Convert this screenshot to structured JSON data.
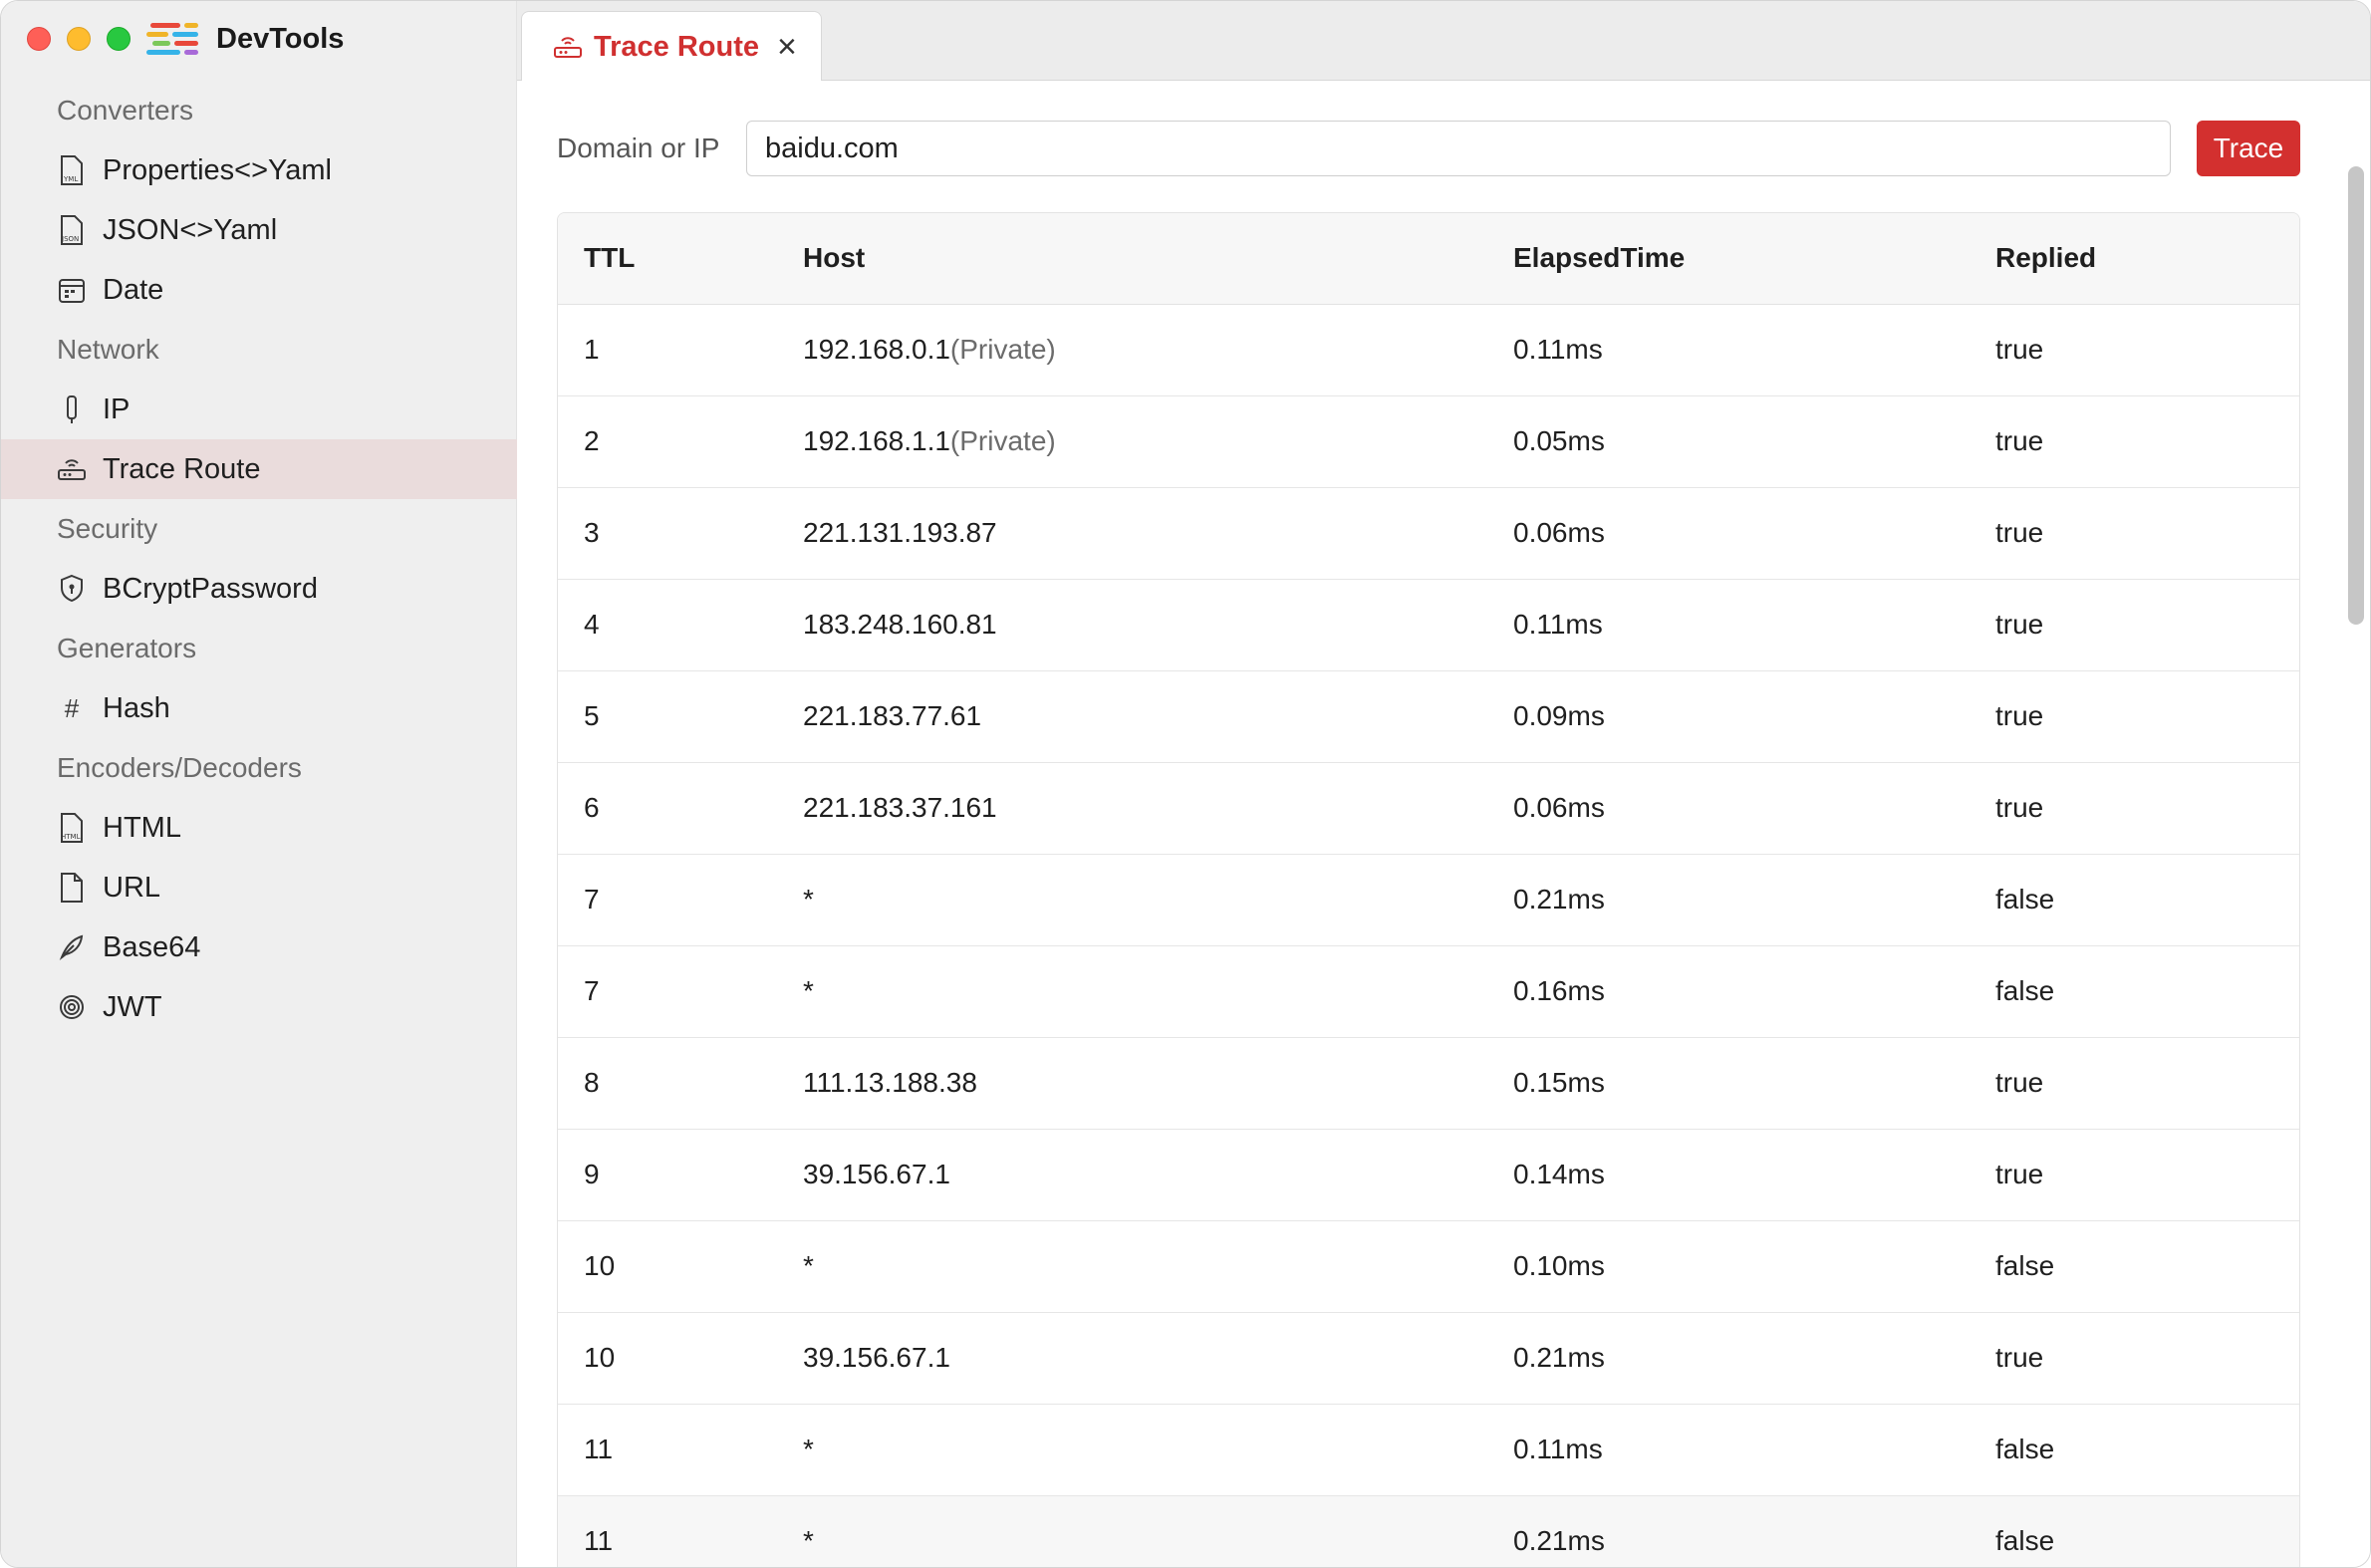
{
  "app": {
    "title": "DevTools"
  },
  "sidebar": {
    "categories": [
      {
        "label": "Converters",
        "items": [
          {
            "label": "Properties<>Yaml",
            "icon": "yaml-file-icon"
          },
          {
            "label": "JSON<>Yaml",
            "icon": "json-file-icon"
          },
          {
            "label": "Date",
            "icon": "calendar-icon"
          }
        ]
      },
      {
        "label": "Network",
        "items": [
          {
            "label": "IP",
            "icon": "ip-icon"
          },
          {
            "label": "Trace Route",
            "icon": "router-icon",
            "active": true
          }
        ]
      },
      {
        "label": "Security",
        "items": [
          {
            "label": "BCryptPassword",
            "icon": "shield-icon"
          }
        ]
      },
      {
        "label": "Generators",
        "items": [
          {
            "label": "Hash",
            "icon": "hash-icon"
          }
        ]
      },
      {
        "label": "Encoders/Decoders",
        "items": [
          {
            "label": "HTML",
            "icon": "html-file-icon"
          },
          {
            "label": "URL",
            "icon": "file-icon"
          },
          {
            "label": "Base64",
            "icon": "feather-icon"
          },
          {
            "label": "JWT",
            "icon": "fingerprint-icon"
          }
        ]
      }
    ]
  },
  "tab": {
    "label": "Trace Route",
    "close": "×"
  },
  "form": {
    "label": "Domain or IP",
    "value": "baidu.com",
    "button": "Trace"
  },
  "table": {
    "headers": [
      "TTL",
      "Host",
      "ElapsedTime",
      "Replied"
    ],
    "rows": [
      {
        "ttl": "1",
        "host": "192.168.0.1",
        "note": "(Private)",
        "elapsed": "0.11ms",
        "replied": "true"
      },
      {
        "ttl": "2",
        "host": "192.168.1.1",
        "note": "(Private)",
        "elapsed": "0.05ms",
        "replied": "true"
      },
      {
        "ttl": "3",
        "host": "221.131.193.87",
        "note": "",
        "elapsed": "0.06ms",
        "replied": "true"
      },
      {
        "ttl": "4",
        "host": "183.248.160.81",
        "note": "",
        "elapsed": "0.11ms",
        "replied": "true"
      },
      {
        "ttl": "5",
        "host": "221.183.77.61",
        "note": "",
        "elapsed": "0.09ms",
        "replied": "true"
      },
      {
        "ttl": "6",
        "host": "221.183.37.161",
        "note": "",
        "elapsed": "0.06ms",
        "replied": "true"
      },
      {
        "ttl": "7",
        "host": "*",
        "note": "",
        "elapsed": "0.21ms",
        "replied": "false"
      },
      {
        "ttl": "7",
        "host": "*",
        "note": "",
        "elapsed": "0.16ms",
        "replied": "false"
      },
      {
        "ttl": "8",
        "host": "111.13.188.38",
        "note": "",
        "elapsed": "0.15ms",
        "replied": "true"
      },
      {
        "ttl": "9",
        "host": "39.156.67.1",
        "note": "",
        "elapsed": "0.14ms",
        "replied": "true"
      },
      {
        "ttl": "10",
        "host": "*",
        "note": "",
        "elapsed": "0.10ms",
        "replied": "false"
      },
      {
        "ttl": "10",
        "host": "39.156.67.1",
        "note": "",
        "elapsed": "0.21ms",
        "replied": "true"
      },
      {
        "ttl": "11",
        "host": "*",
        "note": "",
        "elapsed": "0.11ms",
        "replied": "false"
      },
      {
        "ttl": "11",
        "host": "*",
        "note": "",
        "elapsed": "0.21ms",
        "replied": "false",
        "highlight": true
      }
    ]
  },
  "colors": {
    "accent": "#d3302f",
    "sidebar_bg": "#efefef",
    "active_item_bg": "#eadcdc"
  }
}
